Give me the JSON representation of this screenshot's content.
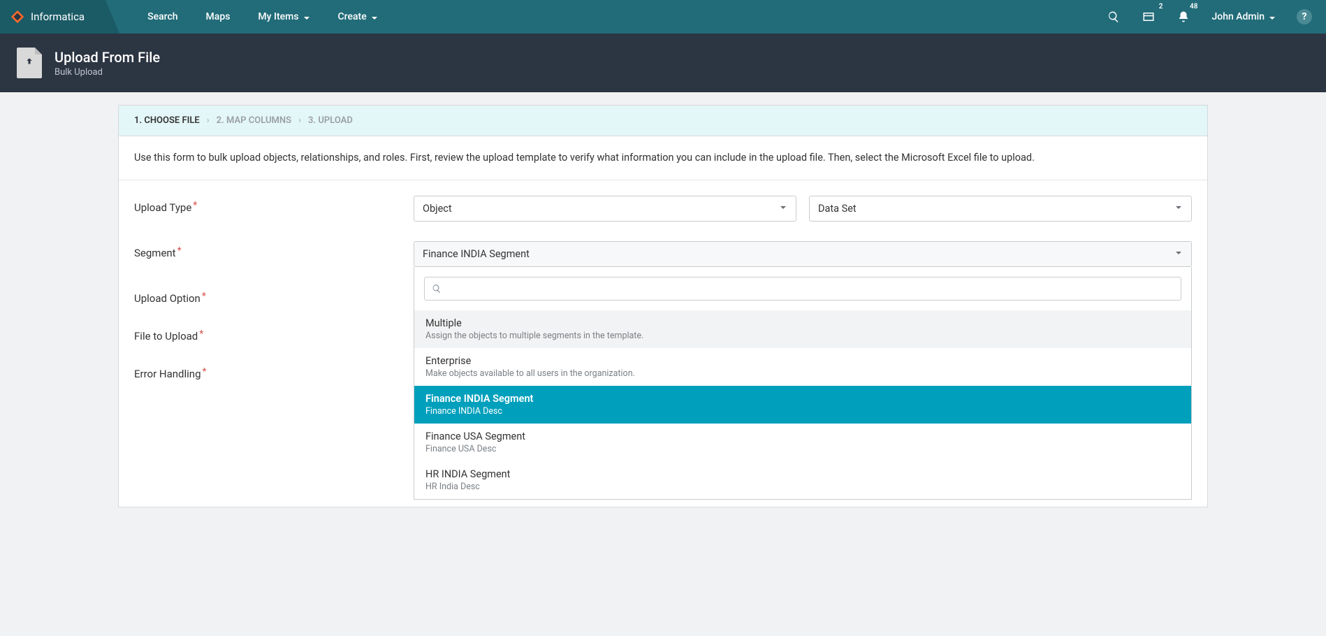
{
  "brand": "Informatica",
  "nav": {
    "search": "Search",
    "maps": "Maps",
    "myitems": "My Items",
    "create": "Create"
  },
  "badges": {
    "box": "2",
    "bell": "48"
  },
  "user": "John Admin",
  "help": "?",
  "header": {
    "title": "Upload From File",
    "subtitle": "Bulk Upload"
  },
  "steps": {
    "s1": "1. CHOOSE FILE",
    "s2": "2. MAP COLUMNS",
    "s3": "3. UPLOAD"
  },
  "instructions": "Use this form to bulk upload objects, relationships, and roles. First, review the upload template to verify what information you can include in the upload file. Then, select the Microsoft Excel file to upload.",
  "form": {
    "uploadType": {
      "label": "Upload Type",
      "sel1": "Object",
      "sel2": "Data Set"
    },
    "segment": {
      "label": "Segment",
      "sel": "Finance INDIA Segment"
    },
    "uploadOption": {
      "label": "Upload Option"
    },
    "fileToUpload": {
      "label": "File to Upload"
    },
    "errorHandling": {
      "label": "Error Handling"
    }
  },
  "dropdown": {
    "searchPlaceholder": "",
    "items": [
      {
        "title": "Multiple",
        "desc": "Assign the objects to multiple segments in the template."
      },
      {
        "title": "Enterprise",
        "desc": "Make objects available to all users in the organization."
      },
      {
        "title": "Finance INDIA Segment",
        "desc": "Finance INDIA Desc"
      },
      {
        "title": "Finance USA Segment",
        "desc": "Finance USA Desc"
      },
      {
        "title": "HR INDIA Segment",
        "desc": "HR India Desc"
      }
    ]
  }
}
